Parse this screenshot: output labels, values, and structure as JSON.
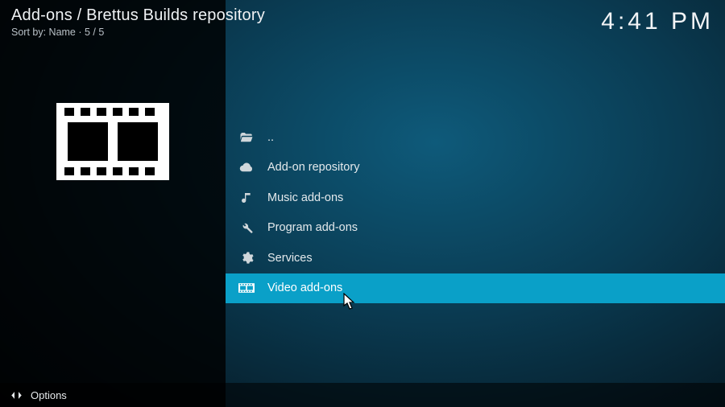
{
  "header": {
    "title": "Add-ons / Brettus Builds repository",
    "sort_label": "Sort by: Name  ·  5 / 5",
    "clock": "4:41 PM"
  },
  "list": {
    "items": [
      {
        "icon": "folder-open-icon",
        "label": ".."
      },
      {
        "icon": "cloud-icon",
        "label": "Add-on repository"
      },
      {
        "icon": "music-icon",
        "label": "Music add-ons"
      },
      {
        "icon": "tools-icon",
        "label": "Program add-ons"
      },
      {
        "icon": "gear-icon",
        "label": "Services"
      },
      {
        "icon": "film-icon",
        "label": "Video add-ons",
        "selected": true
      }
    ]
  },
  "footer": {
    "options_label": "Options"
  }
}
